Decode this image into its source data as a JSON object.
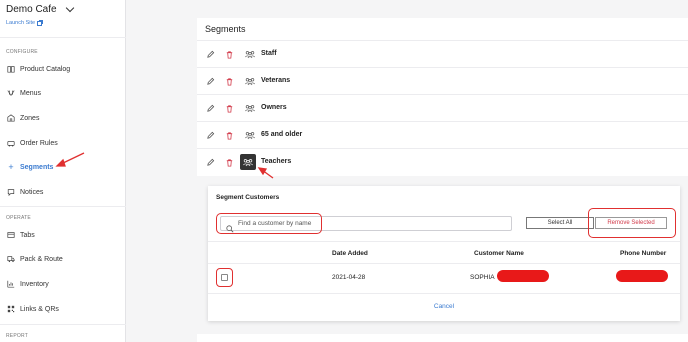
{
  "sidebar": {
    "brand": "Demo Cafe",
    "launch_link": "Launch Site",
    "sections": {
      "configure": "CONFIGURE",
      "operate": "OPERATE",
      "report": "REPORT"
    },
    "items": [
      {
        "label": "Product Catalog",
        "icon": "book-icon"
      },
      {
        "label": "Menus",
        "icon": "menu-icon"
      },
      {
        "label": "Zones",
        "icon": "zones-icon"
      },
      {
        "label": "Order Rules",
        "icon": "rules-icon"
      },
      {
        "label": "Segments",
        "icon": "plus-icon",
        "active": true
      },
      {
        "label": "Notices",
        "icon": "notice-icon"
      },
      {
        "label": "Tabs",
        "icon": "tabs-icon"
      },
      {
        "label": "Pack & Route",
        "icon": "route-icon"
      },
      {
        "label": "Inventory",
        "icon": "inventory-icon"
      },
      {
        "label": "Links & QRs",
        "icon": "qr-icon"
      }
    ]
  },
  "segments": {
    "title": "Segments",
    "rows": [
      {
        "name": "Staff"
      },
      {
        "name": "Veterans"
      },
      {
        "name": "Owners"
      },
      {
        "name": "65 and older"
      },
      {
        "name": "Teachers",
        "selected": true
      }
    ]
  },
  "customers": {
    "title": "Segment Customers",
    "search_placeholder": "Find a customer by name",
    "select_all": "Select All",
    "remove_selected": "Remove Selected",
    "columns": [
      "Date Added",
      "Customer Name",
      "Phone Number"
    ],
    "rows": [
      {
        "date_added": "2021-04-28",
        "customer_name": "SOPHIA",
        "phone": ""
      }
    ],
    "cancel": "Cancel"
  },
  "colors": {
    "accent": "#3b7bd0",
    "danger": "#d23a4a",
    "annotation": "#e03030"
  }
}
